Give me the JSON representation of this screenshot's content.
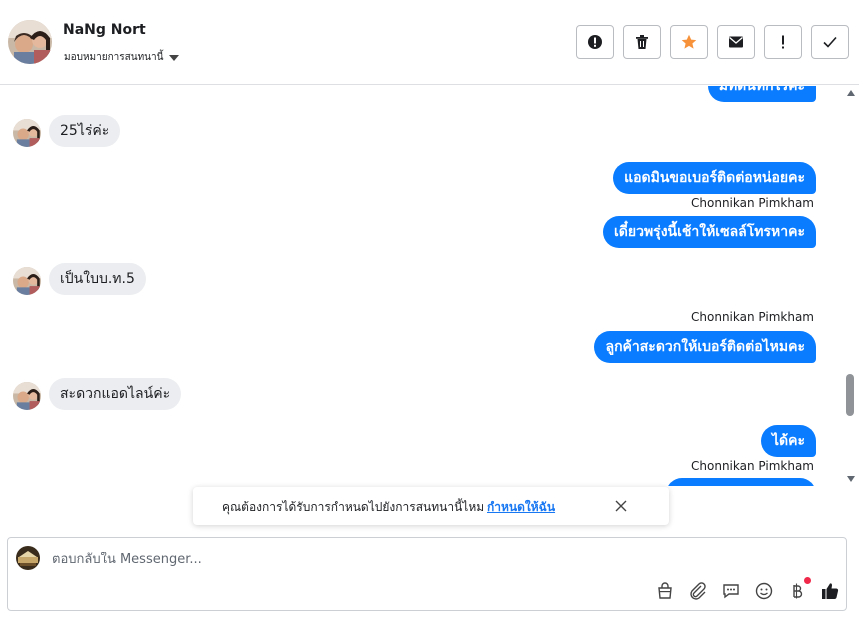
{
  "header": {
    "contact_name": "NaNg Nort",
    "assign_label": "มอบหมายการสนทนานี้"
  },
  "actions": [
    {
      "name": "spam",
      "icon": "alert-circle-icon"
    },
    {
      "name": "delete",
      "icon": "trash-icon"
    },
    {
      "name": "star",
      "icon": "star-icon"
    },
    {
      "name": "mark-unread",
      "icon": "envelope-icon"
    },
    {
      "name": "follow-up",
      "icon": "exclamation-icon"
    },
    {
      "name": "done",
      "icon": "check-icon"
    }
  ],
  "messages": {
    "partial_top": "มีที่ดินที่กี่ไร่คะ",
    "m1": "25ไร่ค่ะ",
    "m2": "แอดมินขอเบอร์ติดต่อหน่อยคะ",
    "sender1": "Chonnikan Pimkham",
    "m3": "เดี๋ยวพรุ่งนี้เช้าให้เซลล์โทรหาคะ",
    "m4": "เป็นใบบ.ท.5",
    "sender2": "Chonnikan Pimkham",
    "m5": "ลูกค้าสะดวกให้เบอร์ติดต่อไหมคะ",
    "m6": "สะดวกแอดไลน์ค่ะ",
    "m7": "ได้คะ",
    "sender3": "Chonnikan Pimkham"
  },
  "toast": {
    "text": "คุณต้องการได้รับการกำหนดไปยังการสนทนานี้ไหม",
    "link": "กำหนดให้ฉัน"
  },
  "composer": {
    "placeholder": "ตอบกลับใน Messenger..."
  },
  "colors": {
    "outgoing_bubble": "#0a7cff",
    "incoming_bubble": "#ebedf0",
    "star": "#f7923a",
    "link": "#1877f2",
    "notification_dot": "#f02849"
  }
}
